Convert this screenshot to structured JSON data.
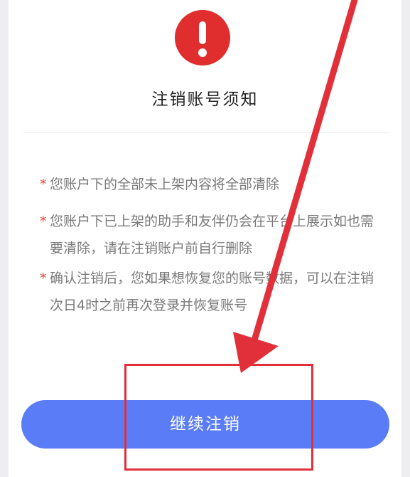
{
  "dialog": {
    "title": "注销账号须知",
    "icon": "exclamation-warning-icon",
    "accent_color": "#e02e2e",
    "notices": [
      {
        "marker": "*",
        "text": "您账户下的全部未上架内容将全部清除"
      },
      {
        "marker": "*",
        "text": "您账户下已上架的助手和友伴仍会在平台上展示如也需要清除，请在注销账户前自行删除"
      },
      {
        "marker": "*",
        "text": "确认注销后，您如果想恢复您的账号数据，可以在注销次日4时之前再次登录并恢复账号"
      }
    ],
    "continue_button": "继续注销",
    "button_color": "#5b7cf7"
  },
  "annotation": {
    "color": "#e2303a",
    "icon": "red-arrow-icon"
  }
}
